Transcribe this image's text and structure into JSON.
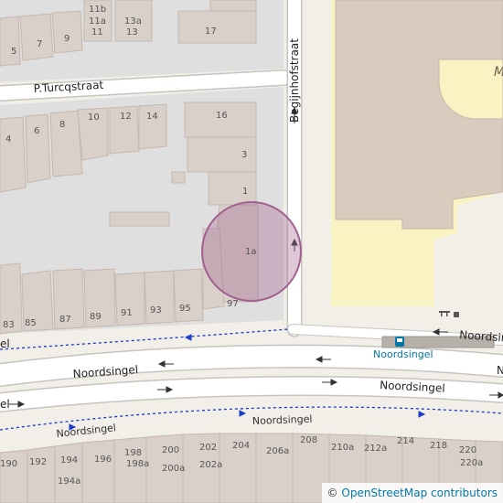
{
  "streets": {
    "p_turcqstraat": "P.Turcqstraat",
    "begijnhofstraat": "Begijnhofstraat",
    "noordsingel": "Noordsingel"
  },
  "stop_name": "Noordsingel",
  "partial_labels": {
    "right_top": "M",
    "right_road": "N",
    "left_road": "el",
    "left_road_2": "el"
  },
  "house_numbers": {
    "top": [
      "11b",
      "11a",
      "11",
      "13a",
      "13",
      "17",
      "5",
      "7",
      "9"
    ],
    "middle": [
      "10",
      "12",
      "14",
      "16",
      "4",
      "6",
      "8",
      "3",
      "1",
      "1a"
    ],
    "lower_row": [
      "83",
      "85",
      "87",
      "89",
      "91",
      "93",
      "95",
      "97"
    ],
    "bottom_row": [
      "190",
      "192",
      "194",
      "194a",
      "196",
      "198",
      "198a",
      "200",
      "200a",
      "202",
      "202a",
      "204",
      "206a",
      "208",
      "210a",
      "212a",
      "214",
      "218",
      "220",
      "220a"
    ]
  },
  "marker": {
    "type": "circle-highlight",
    "color": "#a06090"
  },
  "attribution": {
    "prefix": "©",
    "link_text": "OpenStreetMap contributors"
  },
  "colors": {
    "buildings": "#d9d0c9",
    "land": "#f2efe9",
    "commercial": "#f9f3c4",
    "road": "#ffffff",
    "footway_blue": "#1a3cc8"
  }
}
